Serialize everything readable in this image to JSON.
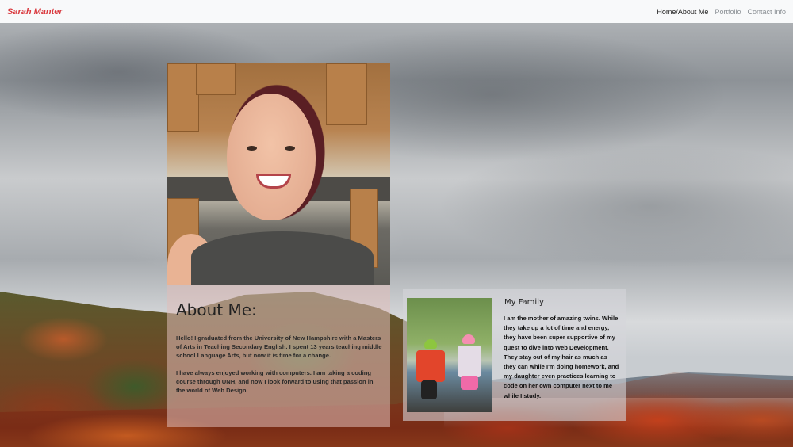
{
  "navbar": {
    "brand": "Sarah Manter",
    "links": [
      {
        "label": "Home/About Me",
        "active": true
      },
      {
        "label": "Portfolio",
        "active": false
      },
      {
        "label": "Contact Info",
        "active": false
      }
    ]
  },
  "about": {
    "heading": "About Me:",
    "paragraphs": [
      "Hello! I graduated from the University of New Hampshire with a Masters of Arts in Teaching Secondary English. I spent 13 years teaching middle school Language Arts, but now it is time for a change.",
      "I have always enjoyed working with computers. I am taking a coding course through UNH, and now I look forward to using that passion in the world of Web Design."
    ]
  },
  "family": {
    "title": "My Family",
    "text": "I am the mother of amazing twins. While they take up a lot of time and energy, they have been super supportive of my quest to dive into Web Development. They stay out of my hair as much as they can while I'm doing homework, and my daughter even practices learning to code on her own computer next to me while I study."
  },
  "colors": {
    "brand": "#d93a3f",
    "navbar_bg": "#f8f9fa",
    "nav_active": "#222222",
    "nav_inactive": "#8a8f94"
  }
}
